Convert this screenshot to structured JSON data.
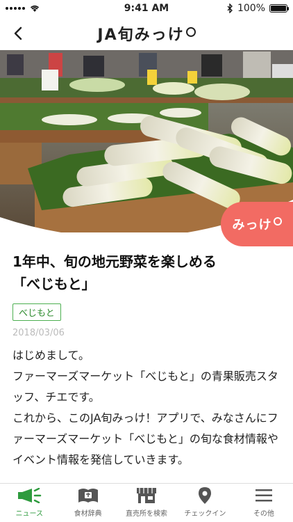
{
  "status_bar": {
    "time": "9:41 AM",
    "battery": "100%",
    "battery_level": 1.0
  },
  "nav": {
    "title": "JA旬みっけ",
    "back_icon": "chevron-left-icon"
  },
  "hero": {
    "image_alt": "daikon radishes at farmers market",
    "badge": "みっけ"
  },
  "article": {
    "title_line1": "1年中、旬の地元野菜を楽しめる",
    "title_line2": "「べじもと」",
    "tag": "べじもと",
    "date": "2018/03/06",
    "paragraphs": [
      "はじめまして。",
      "ファーマーズマーケット「べじもと」の青果販売スタッフ、チエです。",
      "これから、このJA旬みっけ！アプリで、みなさんにファーマーズマーケット「べじもと」の旬な食材情報やイベント情報を発信していきます。"
    ]
  },
  "tabs": [
    {
      "label": "ニュース",
      "icon": "megaphone-icon",
      "active": true
    },
    {
      "label": "食材辞典",
      "icon": "book-icon",
      "active": false
    },
    {
      "label": "直売所を検索",
      "icon": "store-icon",
      "active": false
    },
    {
      "label": "チェックイン",
      "icon": "map-pin-icon",
      "active": false
    },
    {
      "label": "その他",
      "icon": "menu-icon",
      "active": false
    }
  ],
  "colors": {
    "accent_green": "#2e9b3e",
    "badge_red": "#f26b63"
  }
}
